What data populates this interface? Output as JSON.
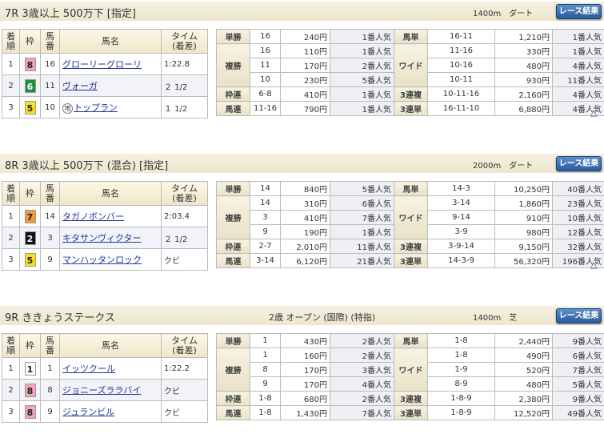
{
  "headers": {
    "rank": "着順",
    "waku": "枠",
    "num": "馬番",
    "name": "馬名",
    "time": "タイム（着差）"
  },
  "result_button": "レース結果",
  "scroll_top_icon": "up-triangle-icon",
  "frame_colors": {
    "1": "#ffffff",
    "2": "#111111",
    "3": "#e33b3b",
    "4": "#3b6fd0",
    "5": "#f5e31a",
    "6": "#1f8f3a",
    "7": "#f59a3a",
    "8": "#f5a3b8"
  },
  "races": [
    {
      "title": "7R 3歳以上 500万下 [指定]",
      "middle": "",
      "distance": "1400m",
      "surface": "ダート",
      "results": [
        {
          "rank": "1",
          "waku": 8,
          "num": "16",
          "name": "グローリーグローリ",
          "badge": "",
          "time": "1:22.8"
        },
        {
          "rank": "2",
          "waku": 6,
          "num": "11",
          "name": "ヴォーガ",
          "badge": "",
          "time": "２ 1/2"
        },
        {
          "rank": "3",
          "waku": 5,
          "num": "10",
          "name": "トップラン",
          "badge": "地",
          "time": "１ 1/2"
        }
      ],
      "payouts": [
        {
          "left_label": "単勝",
          "left": [
            [
              "16",
              "240円",
              "1番人気"
            ]
          ],
          "right_label": "馬単",
          "right": [
            [
              "16-11",
              "1,210円",
              "1番人気"
            ]
          ]
        },
        {
          "left_label": "複勝",
          "left": [
            [
              "16",
              "110円",
              "1番人気"
            ],
            [
              "11",
              "170円",
              "2番人気"
            ],
            [
              "10",
              "230円",
              "5番人気"
            ]
          ],
          "right_label": "ワイド",
          "right": [
            [
              "11-16",
              "330円",
              "1番人気"
            ],
            [
              "10-16",
              "480円",
              "4番人気"
            ],
            [
              "10-11",
              "930円",
              "11番人気"
            ]
          ]
        },
        {
          "left_label": "枠連",
          "left": [
            [
              "6-8",
              "410円",
              "1番人気"
            ]
          ],
          "right_label": "3連複",
          "right": [
            [
              "10-11-16",
              "2,160円",
              "4番人気"
            ]
          ]
        },
        {
          "left_label": "馬連",
          "left": [
            [
              "11-16",
              "790円",
              "1番人気"
            ]
          ],
          "right_label": "3連単",
          "right": [
            [
              "16-11-10",
              "6,880円",
              "4番人気"
            ]
          ]
        }
      ]
    },
    {
      "title": "8R 3歳以上 500万下 (混合) [指定]",
      "middle": "",
      "distance": "2000m",
      "surface": "ダート",
      "results": [
        {
          "rank": "1",
          "waku": 7,
          "num": "14",
          "name": "タガノボンバー",
          "badge": "",
          "time": "2:03.4"
        },
        {
          "rank": "2",
          "waku": 2,
          "num": "3",
          "name": "キタサンヴィクター",
          "badge": "",
          "time": "２ 1/2"
        },
        {
          "rank": "3",
          "waku": 5,
          "num": "9",
          "name": "マンハッタンロック",
          "badge": "",
          "time": "クビ"
        }
      ],
      "payouts": [
        {
          "left_label": "単勝",
          "left": [
            [
              "14",
              "840円",
              "5番人気"
            ]
          ],
          "right_label": "馬単",
          "right": [
            [
              "14-3",
              "10,250円",
              "40番人気"
            ]
          ]
        },
        {
          "left_label": "複勝",
          "left": [
            [
              "14",
              "310円",
              "6番人気"
            ],
            [
              "3",
              "410円",
              "7番人気"
            ],
            [
              "9",
              "190円",
              "1番人気"
            ]
          ],
          "right_label": "ワイド",
          "right": [
            [
              "3-14",
              "1,860円",
              "23番人気"
            ],
            [
              "9-14",
              "910円",
              "10番人気"
            ],
            [
              "3-9",
              "980円",
              "12番人気"
            ]
          ]
        },
        {
          "left_label": "枠連",
          "left": [
            [
              "2-7",
              "2,010円",
              "11番人気"
            ]
          ],
          "right_label": "3連複",
          "right": [
            [
              "3-9-14",
              "9,150円",
              "32番人気"
            ]
          ]
        },
        {
          "left_label": "馬連",
          "left": [
            [
              "3-14",
              "6,120円",
              "21番人気"
            ]
          ],
          "right_label": "3連単",
          "right": [
            [
              "14-3-9",
              "56,320円",
              "196番人気"
            ]
          ]
        }
      ]
    },
    {
      "title": "9R ききょうステークス",
      "middle": "2歳 オープン (国際) (特指)",
      "distance": "1400m",
      "surface": "芝",
      "results": [
        {
          "rank": "1",
          "waku": 1,
          "num": "1",
          "name": "イッツクール",
          "badge": "",
          "time": "1:22.2"
        },
        {
          "rank": "2",
          "waku": 8,
          "num": "8",
          "name": "ジョニーズララバイ",
          "badge": "",
          "time": "クビ"
        },
        {
          "rank": "3",
          "waku": 8,
          "num": "9",
          "name": "ジュランビル",
          "badge": "",
          "time": "クビ"
        }
      ],
      "payouts": [
        {
          "left_label": "単勝",
          "left": [
            [
              "1",
              "430円",
              "2番人気"
            ]
          ],
          "right_label": "馬単",
          "right": [
            [
              "1-8",
              "2,440円",
              "9番人気"
            ]
          ]
        },
        {
          "left_label": "複勝",
          "left": [
            [
              "1",
              "160円",
              "2番人気"
            ],
            [
              "8",
              "170円",
              "3番人気"
            ],
            [
              "9",
              "170円",
              "4番人気"
            ]
          ],
          "right_label": "ワイド",
          "right": [
            [
              "1-8",
              "490円",
              "6番人気"
            ],
            [
              "1-9",
              "520円",
              "7番人気"
            ],
            [
              "8-9",
              "480円",
              "5番人気"
            ]
          ]
        },
        {
          "left_label": "枠連",
          "left": [
            [
              "1-8",
              "680円",
              "2番人気"
            ]
          ],
          "right_label": "3連複",
          "right": [
            [
              "1-8-9",
              "2,380円",
              "9番人気"
            ]
          ]
        },
        {
          "left_label": "馬連",
          "left": [
            [
              "1-8",
              "1,430円",
              "7番人気"
            ]
          ],
          "right_label": "3連単",
          "right": [
            [
              "1-8-9",
              "12,520円",
              "49番人気"
            ]
          ]
        }
      ]
    }
  ]
}
